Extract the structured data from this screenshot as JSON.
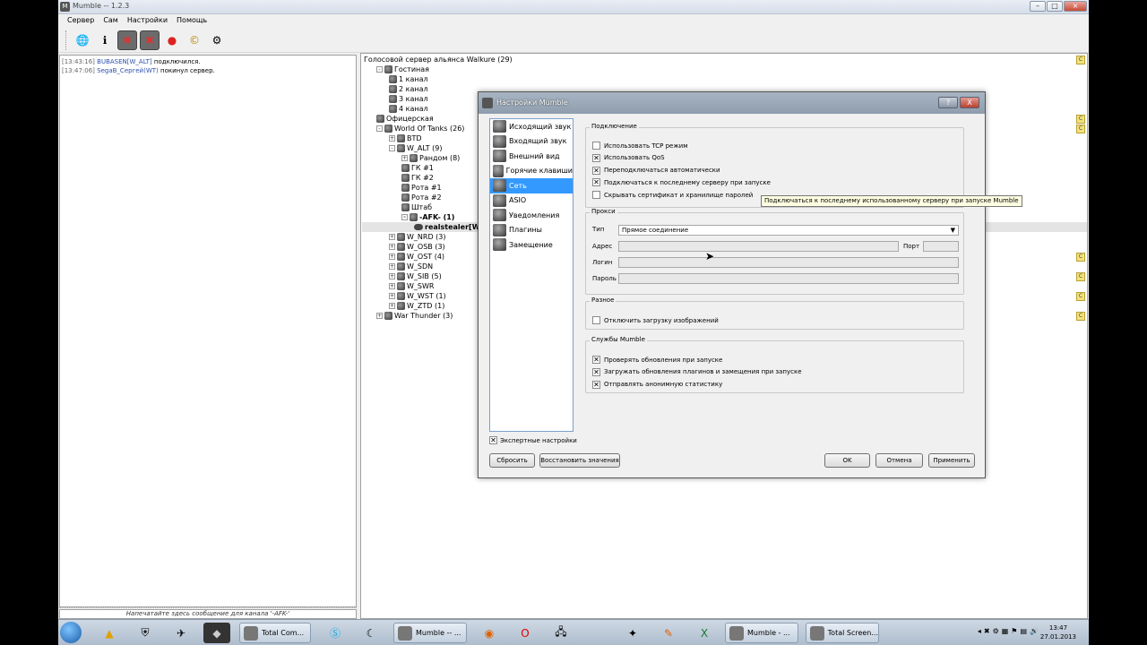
{
  "window": {
    "title": "Mumble -- 1.2.3"
  },
  "menu": [
    "Сервер",
    "Сам",
    "Настройки",
    "Помощь"
  ],
  "log": [
    {
      "time": "[13:43:16]",
      "user": "BUBASEN[W_ALT]",
      "text": " подключился."
    },
    {
      "time": "[13:47:06]",
      "user": "SegaB_Сергей(WT)",
      "text": " покинул сервер."
    }
  ],
  "message_placeholder": "Напечатайте здесь сообщение для канала '-AFK-'",
  "tree": [
    {
      "label": "Голосовой сервер альянса Walkure (29)",
      "level": 0,
      "exp": "",
      "icon": ""
    },
    {
      "label": "Гостиная",
      "level": 1,
      "exp": "-",
      "icon": "channel"
    },
    {
      "label": "1 канал",
      "level": 2,
      "exp": "",
      "icon": "channel"
    },
    {
      "label": "2 канал",
      "level": 2,
      "exp": "",
      "icon": "channel"
    },
    {
      "label": "3 канал",
      "level": 2,
      "exp": "",
      "icon": "channel"
    },
    {
      "label": "4 канал",
      "level": 2,
      "exp": "",
      "icon": "channel"
    },
    {
      "label": "Офицерская",
      "level": 1,
      "exp": "",
      "icon": "channel"
    },
    {
      "label": "World Of Tanks (26)",
      "level": 1,
      "exp": "-",
      "icon": "channel"
    },
    {
      "label": "BTD",
      "level": 2,
      "exp": "+",
      "icon": "channel"
    },
    {
      "label": "W_ALT (9)",
      "level": 2,
      "exp": "-",
      "icon": "channel"
    },
    {
      "label": "Рандом (8)",
      "level": 3,
      "exp": "+",
      "icon": "channel"
    },
    {
      "label": "ГК #1",
      "level": 3,
      "exp": "",
      "icon": "channel"
    },
    {
      "label": "ГК #2",
      "level": 3,
      "exp": "",
      "icon": "channel"
    },
    {
      "label": "Рота #1",
      "level": 3,
      "exp": "",
      "icon": "channel"
    },
    {
      "label": "Рота #2",
      "level": 3,
      "exp": "",
      "icon": "channel"
    },
    {
      "label": "Штаб",
      "level": 3,
      "exp": "",
      "icon": "channel"
    },
    {
      "label": "-AFK- (1)",
      "level": 3,
      "exp": "-",
      "icon": "channel",
      "bold": true
    },
    {
      "label": "realstealer[W_A",
      "level": 4,
      "exp": "",
      "icon": "user",
      "bold": true,
      "selected": true
    },
    {
      "label": "W_NRD (3)",
      "level": 2,
      "exp": "+",
      "icon": "channel"
    },
    {
      "label": "W_OSB (3)",
      "level": 2,
      "exp": "+",
      "icon": "channel"
    },
    {
      "label": "W_OST (4)",
      "level": 2,
      "exp": "+",
      "icon": "channel"
    },
    {
      "label": "W_SDN",
      "level": 2,
      "exp": "+",
      "icon": "channel"
    },
    {
      "label": "W_SIB (5)",
      "level": 2,
      "exp": "+",
      "icon": "channel"
    },
    {
      "label": "W_SWR",
      "level": 2,
      "exp": "+",
      "icon": "channel"
    },
    {
      "label": "W_WST (1)",
      "level": 2,
      "exp": "+",
      "icon": "channel"
    },
    {
      "label": "W_ZTD (1)",
      "level": 2,
      "exp": "+",
      "icon": "channel"
    },
    {
      "label": "War Thunder (3)",
      "level": 1,
      "exp": "+",
      "icon": "channel"
    }
  ],
  "dialog": {
    "title": "Настройки Mumble",
    "help": "?",
    "close": "X",
    "categories": [
      "Исходящий звук",
      "Входящий звук",
      "Внешний вид",
      "Горячие клавиши",
      "Сеть",
      "ASIO",
      "Уведомления",
      "Плагины",
      "Замещение"
    ],
    "selected_category": 4,
    "connection": {
      "title": "Подключение",
      "options": [
        {
          "label": "Использовать TCP режим",
          "checked": false
        },
        {
          "label": "Использовать QoS",
          "checked": true
        },
        {
          "label": "Переподключаться автоматически",
          "checked": true
        },
        {
          "label": "Подключаться к последнему серверу при запуске",
          "checked": true
        },
        {
          "label": "Скрывать сертификат и хранилище паролей",
          "checked": false
        }
      ]
    },
    "proxy": {
      "title": "Прокси",
      "type_label": "Тип",
      "type_value": "Прямое соединение",
      "address_label": "Адрес",
      "port_label": "Порт",
      "login_label": "Логин",
      "password_label": "Пароль"
    },
    "misc": {
      "title": "Разное",
      "options": [
        {
          "label": "Отключить загрузку изображений",
          "checked": false
        }
      ]
    },
    "services": {
      "title": "Службы Mumble",
      "options": [
        {
          "label": "Проверять обновления при запуске",
          "checked": true
        },
        {
          "label": "Загружать обновления плагинов и замещения при запуске",
          "checked": true
        },
        {
          "label": "Отправлять анонимную статистику",
          "checked": true
        }
      ]
    },
    "expert": {
      "label": "Экспертные настройки",
      "checked": true
    },
    "buttons": {
      "reset": "Сбросить",
      "restore": "Восстановить значения",
      "ok": "OK",
      "cancel": "Отмена",
      "apply": "Применить"
    }
  },
  "tooltip": "Подключаться к последнему использованному серверу при запуске Mumble",
  "taskbar": {
    "tasks": [
      "Total Com...",
      "Mumble -- ...",
      "Mumble - ...",
      "Total Screen..."
    ],
    "clock_time": "13:47",
    "clock_date": "27.01.2013"
  }
}
